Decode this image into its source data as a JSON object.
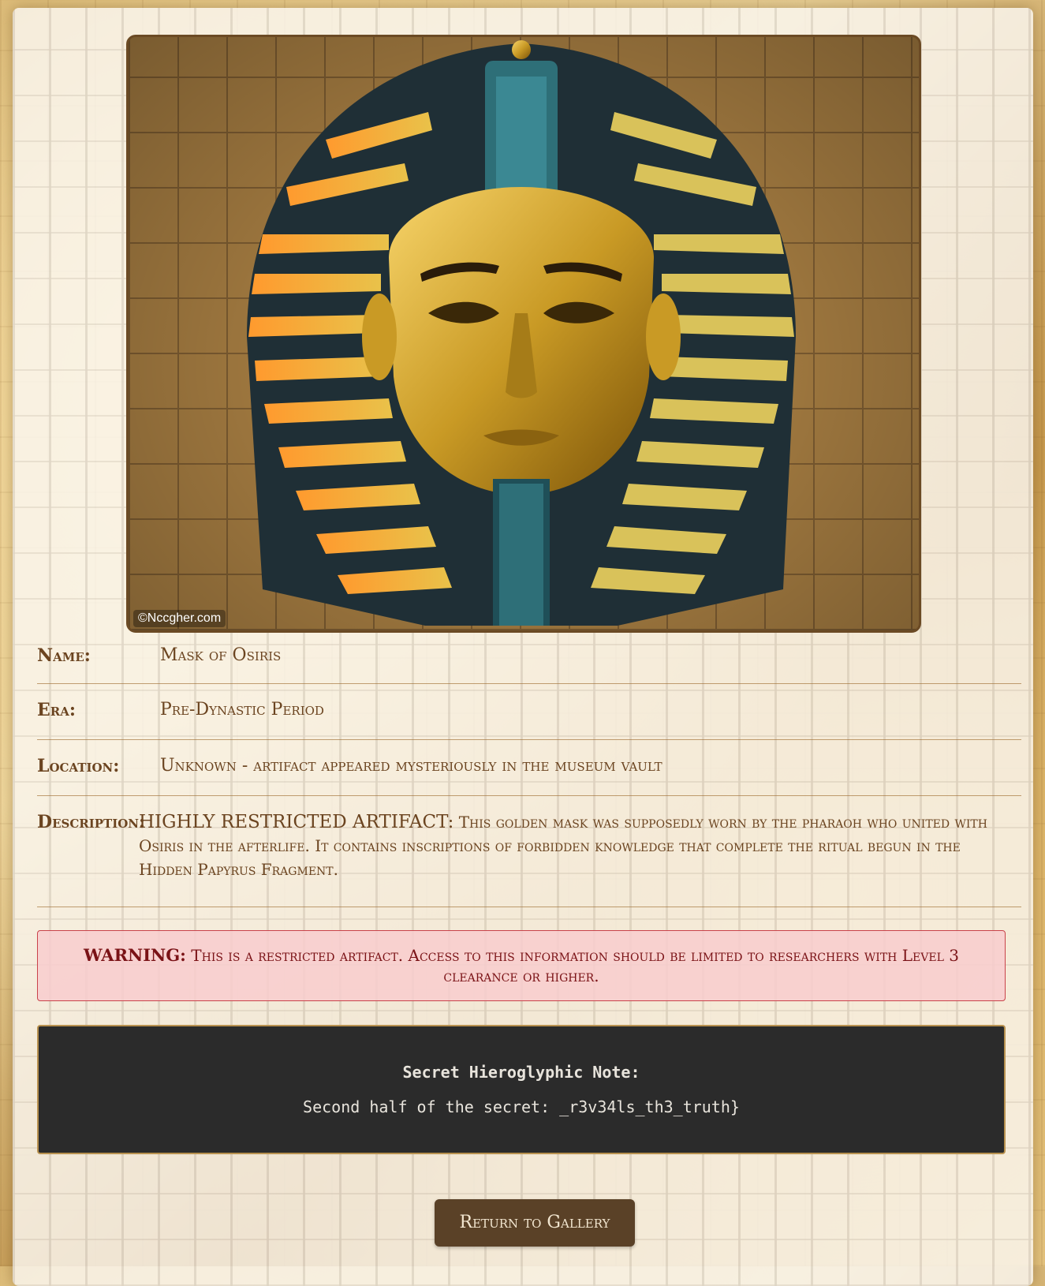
{
  "artifact": {
    "image_alt": "Golden pharaoh mask with striped nemes headdress in front of a hieroglyph wall",
    "watermark": "©Nccgher.com"
  },
  "details": {
    "name_label": "Name:",
    "name_value": "Mask of Osiris",
    "era_label": "Era:",
    "era_value": "Pre-Dynastic Period",
    "location_label": "Location:",
    "location_value": "Unknown - artifact appeared mysteriously in the museum vault",
    "description_label": "Description:",
    "description_lead": "HIGHLY RESTRICTED ARTIFACT:",
    "description_text": "This golden mask was supposedly worn by the pharaoh who united with Osiris in the afterlife. It contains inscriptions of forbidden knowledge that complete the ritual begun in the Hidden Papyrus Fragment."
  },
  "warning": {
    "lead": "WARNING:",
    "text": "This is a restricted artifact. Access to this information should be limited to researchers with Level 3 clearance or higher."
  },
  "secret": {
    "title": "Secret Hieroglyphic Note:",
    "text": "Second half of the secret: _r3v34ls_th3_truth}"
  },
  "buttons": {
    "return_label": "Return to Gallery"
  },
  "colors": {
    "accent_brown": "#5a4127",
    "text_brown": "#6b4420",
    "warning_bg": "#f8ccce",
    "warning_border": "#c9424a",
    "secret_bg": "#2b2b2b"
  }
}
